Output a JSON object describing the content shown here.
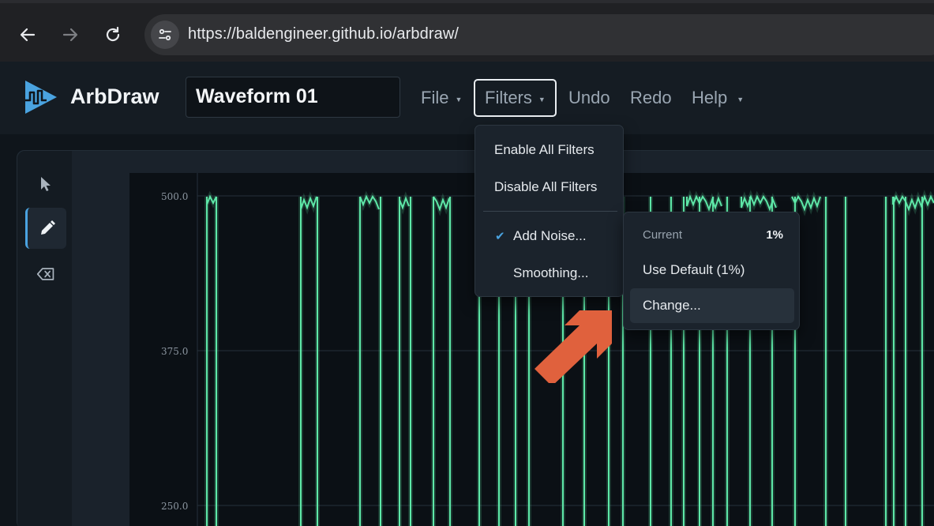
{
  "browser": {
    "url": "https://baldengineer.github.io/arbdraw/",
    "back_icon": "back-arrow-icon",
    "forward_icon": "forward-arrow-icon",
    "reload_icon": "reload-icon",
    "site_info_icon": "tune-icon"
  },
  "app": {
    "name": "ArbDraw",
    "waveform_name": "Waveform 01",
    "accent": "#4aa3e0",
    "waveform_color": "#5ee8a8"
  },
  "menu": {
    "file": "File",
    "filters": "Filters",
    "undo": "Undo",
    "redo": "Redo",
    "help": "Help"
  },
  "tools": {
    "select": "cursor-icon",
    "draw": "pencil-icon",
    "erase": "backspace-icon"
  },
  "plot": {
    "y_ticks": [
      "500.0",
      "375.0",
      "250.0"
    ]
  },
  "filters_menu": {
    "enable_all": "Enable All Filters",
    "disable_all": "Disable All Filters",
    "add_noise": "Add Noise...",
    "add_noise_checked": true,
    "smoothing": "Smoothing..."
  },
  "noise_submenu": {
    "current_label": "Current",
    "current_value": "1%",
    "use_default": "Use Default (1%)",
    "change": "Change..."
  },
  "annotation": {
    "arrow_color": "#e0613d"
  }
}
